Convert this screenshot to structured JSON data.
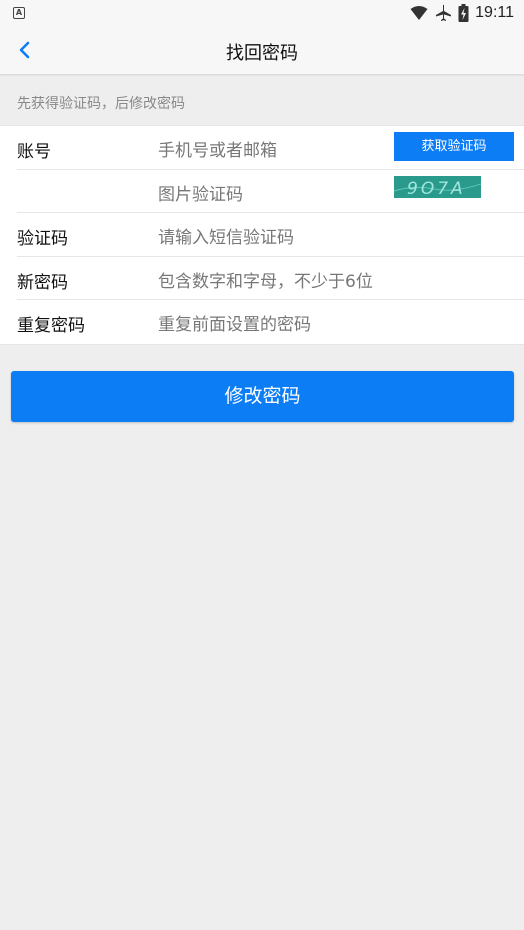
{
  "status": {
    "time": "19:11",
    "a_icon_text": "A"
  },
  "nav": {
    "title": "找回密码"
  },
  "hint": "先获得验证码，后修改密码",
  "form": {
    "account": {
      "label": "账号",
      "placeholder": "手机号或者邮箱",
      "button": "获取验证码"
    },
    "captcha": {
      "placeholder": "图片验证码",
      "image_text": "9O7A"
    },
    "sms": {
      "label": "验证码",
      "placeholder": "请输入短信验证码"
    },
    "new_password": {
      "label": "新密码",
      "placeholder": "包含数字和字母，不少于6位"
    },
    "repeat_password": {
      "label": "重复密码",
      "placeholder": "重复前面设置的密码"
    }
  },
  "submit_label": "修改密码",
  "colors": {
    "accent": "#0d7df6",
    "captcha_bg": "#2a9a8c",
    "background": "#eeeeee"
  }
}
